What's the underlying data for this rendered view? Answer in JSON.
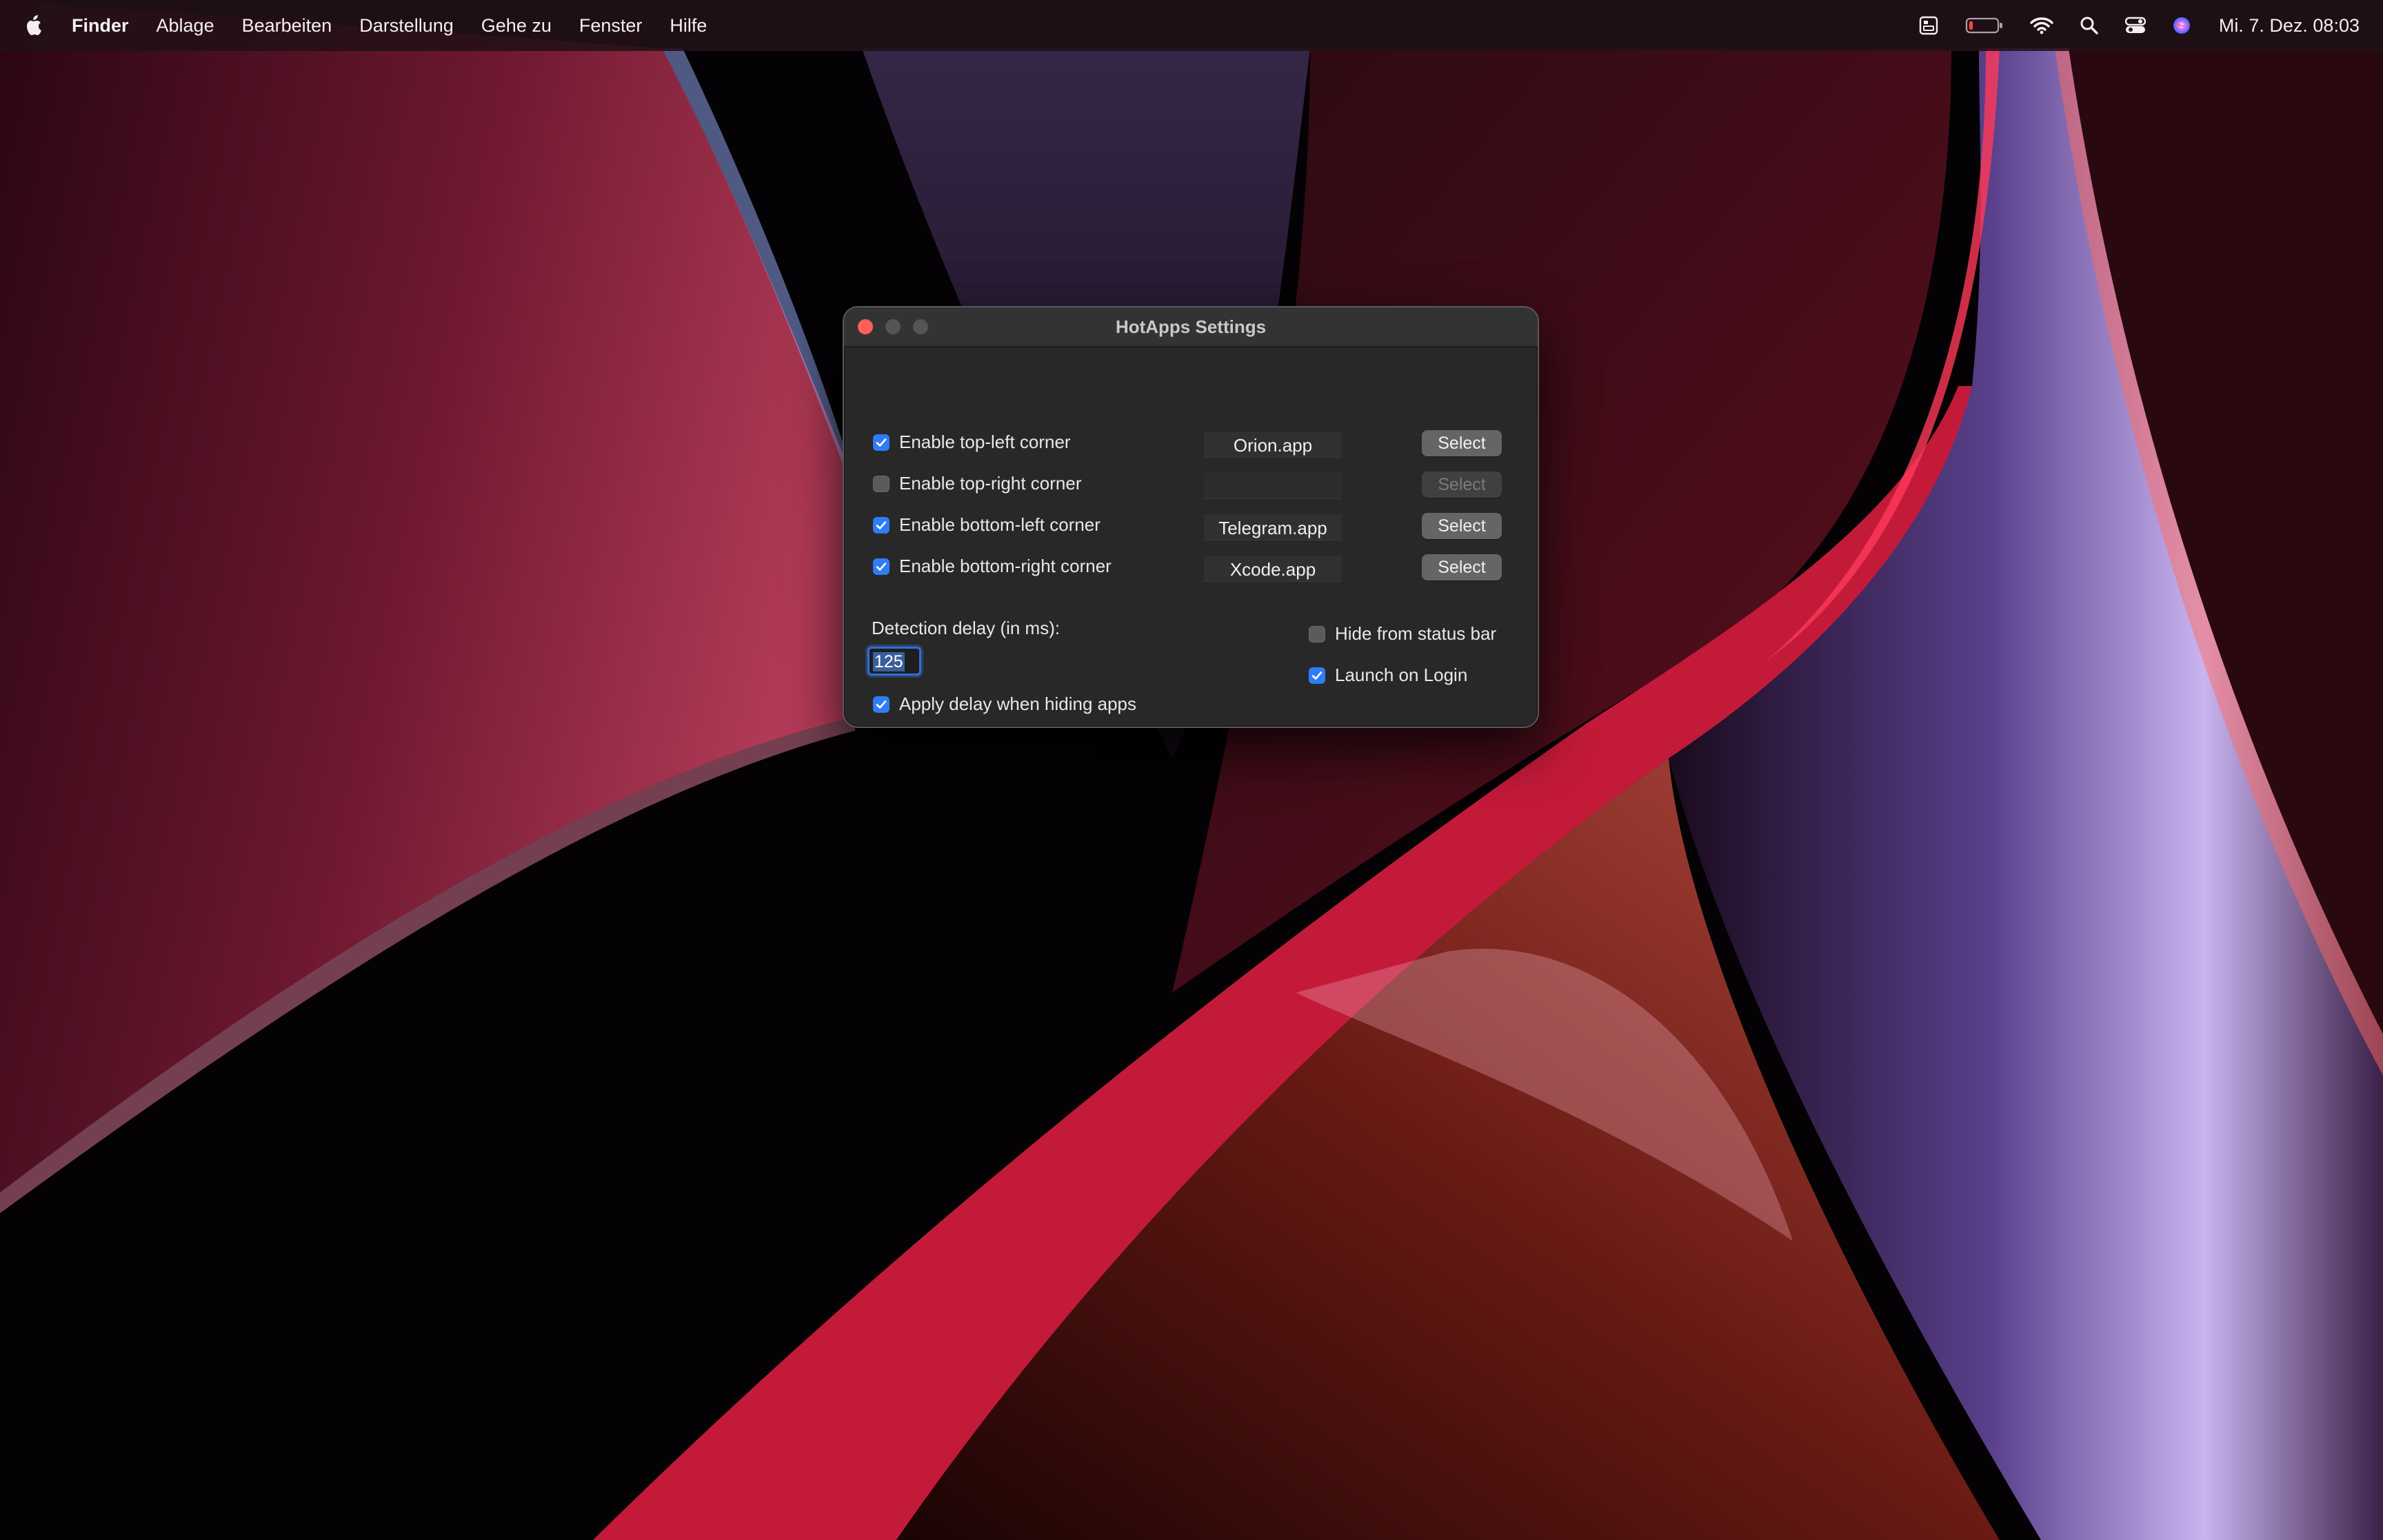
{
  "menubar": {
    "app_name": "Finder",
    "items": [
      "Ablage",
      "Bearbeiten",
      "Darstellung",
      "Gehe zu",
      "Fenster",
      "Hilfe"
    ],
    "clock": "Mi. 7. Dez.  08:03",
    "status_icons": [
      "stage-manager-icon",
      "battery-icon",
      "wifi-icon",
      "spotlight-icon",
      "control-center-icon",
      "siri-icon"
    ]
  },
  "window": {
    "title": "HotApps Settings",
    "corners": [
      {
        "label": "Enable top-left corner",
        "checked": true,
        "app": "Orion.app",
        "button": "Select",
        "enabled": true
      },
      {
        "label": "Enable top-right corner",
        "checked": false,
        "app": "",
        "button": "Select",
        "enabled": false
      },
      {
        "label": "Enable bottom-left corner",
        "checked": true,
        "app": "Telegram.app",
        "button": "Select",
        "enabled": true
      },
      {
        "label": "Enable bottom-right corner",
        "checked": true,
        "app": "Xcode.app",
        "button": "Select",
        "enabled": true
      }
    ],
    "delay": {
      "label": "Detection delay (in ms):",
      "value": "125"
    },
    "apply_delay": {
      "label": "Apply delay when hiding apps",
      "checked": true
    },
    "hide_status": {
      "label": "Hide from status bar",
      "checked": false
    },
    "launch_login": {
      "label": "Launch on Login",
      "checked": true
    }
  },
  "colors": {
    "accent": "#2f7cf6",
    "close": "#ff5f57"
  }
}
